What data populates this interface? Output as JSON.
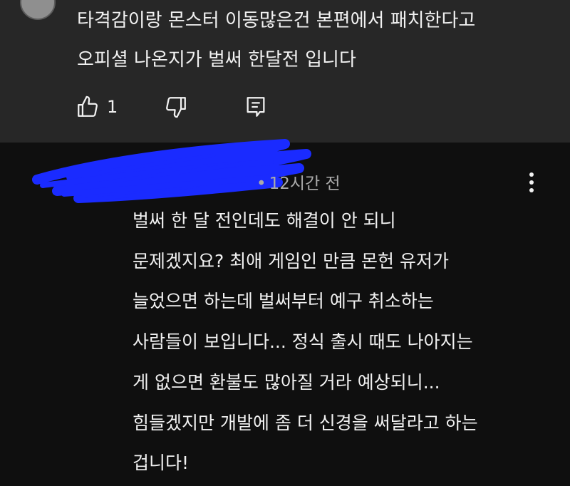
{
  "top_comment": {
    "lines": [
      "타격감이랑 몬스터 이동많은건 본편에서 패치한다고",
      "오피셜 나온지가 벌써 한달전 입니다"
    ],
    "like_count": "1",
    "icons": {
      "like": "thumb-up-icon",
      "dislike": "thumb-down-icon",
      "reply": "comment-reply-icon"
    }
  },
  "reply": {
    "timestamp": "12시간 전",
    "author_redacted": true,
    "redaction_color": "#1a2bff",
    "lines": [
      "벌써 한 달 전인데도 해결이 안 되니",
      "문제겠지요? 최애 게임인 만큼 몬헌 유저가",
      "늘었으면 하는데 벌써부터 예구 취소하는",
      "사람들이 보입니다... 정식 출시 때도 나아지는",
      "게 없으면 환불도 많아질 거라 예상되니...",
      "힘들겠지만 개발에 좀 더 신경을 써달라고 하는",
      "겁니다!"
    ],
    "more_icon": "more-vert-icon"
  },
  "colors": {
    "top_background": "#272727",
    "page_background": "#0f0f0f",
    "text_primary": "#f1f1f1",
    "text_secondary": "#aaaaaa"
  }
}
